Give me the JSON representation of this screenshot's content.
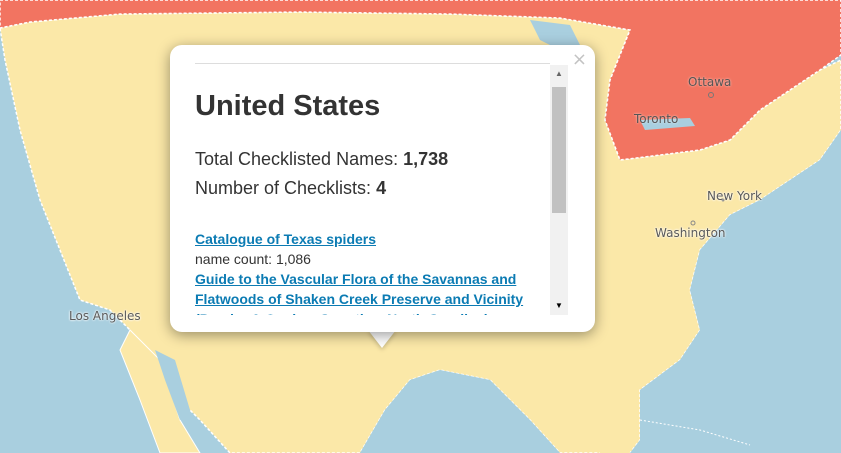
{
  "map": {
    "colors": {
      "water": "#a9cfdf",
      "usa_land": "#fbe8a8",
      "canada_land": "#f27461",
      "mexico_land": "#fbe8a8",
      "border": "#ffffff"
    },
    "cities": [
      {
        "name": "Ottawa",
        "country": "canada"
      },
      {
        "name": "Toronto",
        "country": "canada"
      },
      {
        "name": "New York",
        "country": "usa"
      },
      {
        "name": "Washington",
        "country": "usa"
      },
      {
        "name": "Los Angeles",
        "country": "usa"
      }
    ]
  },
  "popup": {
    "close_label": "×",
    "country_name": "United States",
    "total_label": "Total Checklisted Names: ",
    "total_value": "1,738",
    "number_label": "Number of Checklists: ",
    "number_value": "4",
    "checklists": [
      {
        "title": "Catalogue of Texas spiders",
        "count_text": "name count: 1,086"
      },
      {
        "title": "Guide to the Vascular Flora of the Savannas and Flatwoods of Shaken Creek Preserve and Vicinity (Pender & Onslow Counties, North Carolina)",
        "count_text": ""
      }
    ],
    "scroll_up_icon": "▲",
    "scroll_down_icon": "▼"
  }
}
